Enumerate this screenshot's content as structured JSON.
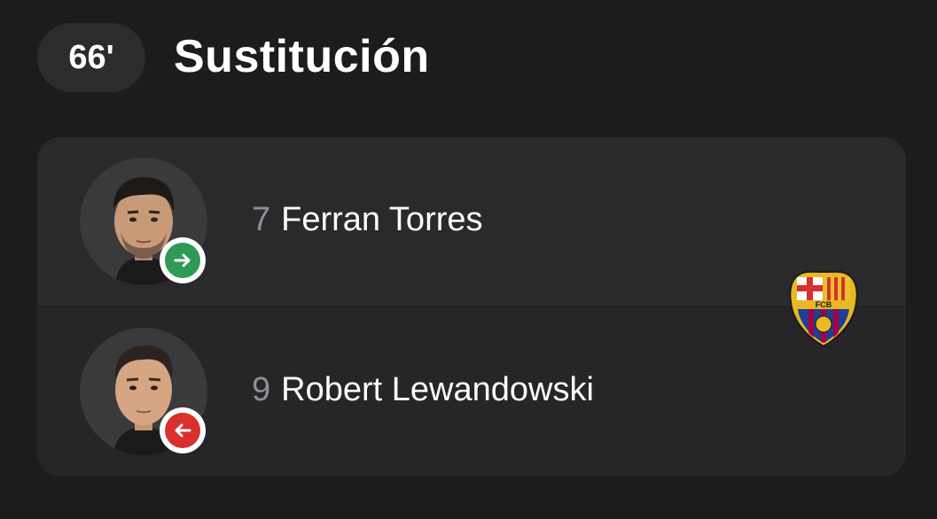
{
  "event": {
    "minute": "66'",
    "title": "Sustitución"
  },
  "substitution": {
    "player_in": {
      "number": "7",
      "name": "Ferran Torres",
      "direction_icon": "arrow-right-icon",
      "color": "#2e9a55"
    },
    "player_out": {
      "number": "9",
      "name": "Robert Lewandowski",
      "direction_icon": "arrow-left-icon",
      "color": "#d8302f"
    }
  },
  "team": {
    "crest_icon": "fc-barcelona-crest-icon",
    "crest_text": "FCB"
  },
  "colors": {
    "background": "#1c1c1e",
    "card": "#252527"
  }
}
